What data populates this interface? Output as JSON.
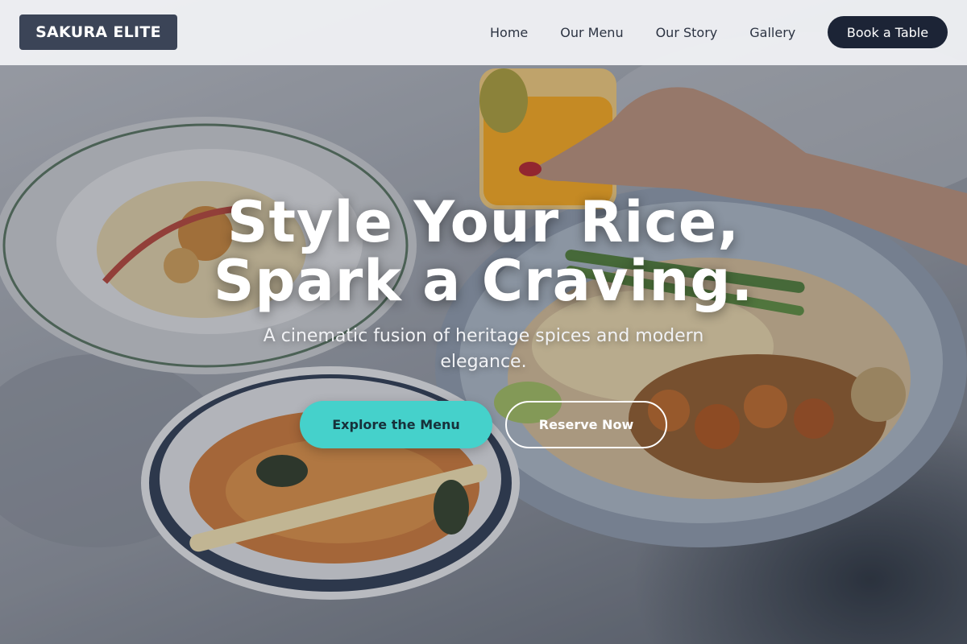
{
  "brand": {
    "name": "SAKURA ELITE"
  },
  "nav": {
    "links": [
      "Home",
      "Our Menu",
      "Our Story",
      "Gallery"
    ],
    "book_label": "Book a Table"
  },
  "hero": {
    "headline_line1": "Style Your Rice,",
    "headline_line2": "Spark a Craving.",
    "subtitle": "A cinematic fusion of heritage spices and modern elegance.",
    "primary_cta": "Explore the Menu",
    "secondary_cta": "Reserve Now",
    "background_image": "food-spread-photo"
  },
  "colors": {
    "logo_bg": "#3b4457",
    "book_button_bg": "#1c2436",
    "primary_cta_bg": "#45d1cb",
    "text_light": "#ffffff"
  }
}
